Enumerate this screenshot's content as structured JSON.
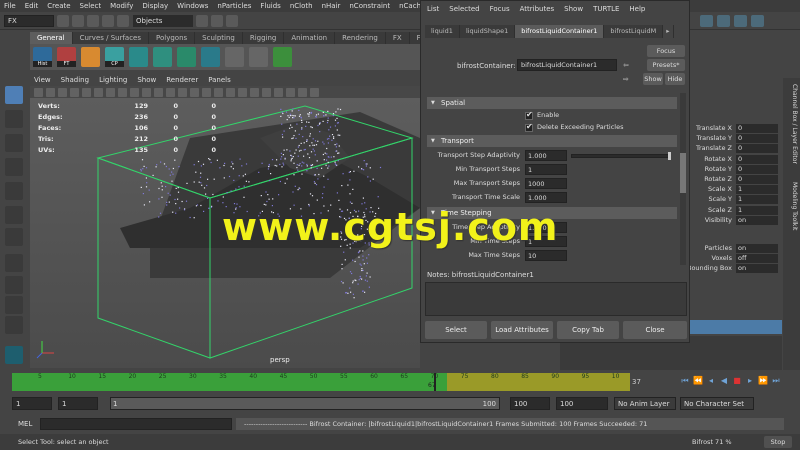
{
  "menu": [
    "File",
    "Edit",
    "Create",
    "Select",
    "Modify",
    "Display",
    "Windows",
    "nParticles",
    "Fluids",
    "nCloth",
    "nHair",
    "nConstraint",
    "nCache"
  ],
  "status": {
    "mode": "FX",
    "object_selector": "Objects"
  },
  "shelf": {
    "tabs": [
      "General",
      "Curves / Surfaces",
      "Polygons",
      "Sculpting",
      "Rigging",
      "Animation",
      "Rendering",
      "FX",
      "FX Cach"
    ],
    "active_tab": "General",
    "buttons": [
      {
        "label": "Hist",
        "color": "#2e6a9a"
      },
      {
        "label": "FT",
        "color": "#b04040"
      },
      {
        "label": "CP",
        "color": "#3aa0a0"
      }
    ]
  },
  "viewport": {
    "menu": [
      "View",
      "Shading",
      "Lighting",
      "Show",
      "Renderer",
      "Panels"
    ],
    "hud": [
      {
        "label": "Verts:",
        "v1": "129",
        "v2": "0",
        "v3": "0"
      },
      {
        "label": "Edges:",
        "v1": "236",
        "v2": "0",
        "v3": "0"
      },
      {
        "label": "Faces:",
        "v1": "106",
        "v2": "0",
        "v3": "0"
      },
      {
        "label": "Tris:",
        "v1": "212",
        "v2": "0",
        "v3": "0"
      },
      {
        "label": "UVs:",
        "v1": "135",
        "v2": "0",
        "v3": "0"
      }
    ],
    "camera": "persp"
  },
  "attribute_editor": {
    "menu": [
      "List",
      "Selected",
      "Focus",
      "Attributes",
      "Show",
      "TURTLE",
      "Help"
    ],
    "tabs": [
      "liquid1",
      "liquidShape1",
      "bifrostLiquidContainer1",
      "bifrostLiquidM"
    ],
    "active_tab": "bifrostLiquidContainer1",
    "node_label": "bifrostContainer:",
    "node_value": "bifrostLiquidContainer1",
    "side_buttons": {
      "focus": "Focus",
      "presets": "Presets*",
      "show": "Show",
      "hide": "Hide"
    },
    "sections": {
      "spatial": "Spatial",
      "transport": "Transport",
      "time_stepping": "Time Stepping"
    },
    "checkboxes": [
      "Enable",
      "Delete Exceeding Particles"
    ],
    "transport_attrs": [
      {
        "label": "Transport Step Adaptivity",
        "value": "1.000",
        "slider": true,
        "fraction": 1.0
      },
      {
        "label": "Min Transport Steps",
        "value": "1",
        "slider": false
      },
      {
        "label": "Max Transport Steps",
        "value": "1000",
        "slider": false
      },
      {
        "label": "Transport Time Scale",
        "value": "1.000",
        "slider": false
      }
    ],
    "time_attrs": [
      {
        "label": "Time Step Adaptivity",
        "value": "1.000"
      },
      {
        "label": "Min Time Steps",
        "value": "1"
      },
      {
        "label": "Max Time Steps",
        "value": "10"
      }
    ],
    "notes_label": "Notes:  bifrostLiquidContainer1",
    "bottom_buttons": [
      "Select",
      "Load Attributes",
      "Copy Tab",
      "Close"
    ]
  },
  "channel_box": {
    "attrs": [
      {
        "label": "Translate X",
        "value": "0"
      },
      {
        "label": "Translate Y",
        "value": "0"
      },
      {
        "label": "Translate Z",
        "value": "0"
      },
      {
        "label": "Rotate X",
        "value": "0"
      },
      {
        "label": "Rotate Y",
        "value": "0"
      },
      {
        "label": "Rotate Z",
        "value": "0"
      },
      {
        "label": "Scale X",
        "value": "1"
      },
      {
        "label": "Scale Y",
        "value": "1"
      },
      {
        "label": "Scale Z",
        "value": "1"
      },
      {
        "label": "Visibility",
        "value": "on"
      }
    ],
    "shape_attrs": [
      {
        "label": "Particles",
        "value": "on"
      },
      {
        "label": "Voxels",
        "value": "off"
      },
      {
        "label": "Bounding Box",
        "value": "on"
      }
    ],
    "side_tabs": [
      "Channel Box / Layer Editor",
      "Modeling Toolkit"
    ]
  },
  "timeline": {
    "ticks": [
      "5",
      "10",
      "15",
      "20",
      "25",
      "30",
      "35",
      "40",
      "45",
      "50",
      "55",
      "60",
      "65",
      "70",
      "75",
      "80",
      "85",
      "90",
      "95",
      "10"
    ],
    "current_frame": "37",
    "playhead_label": "67"
  },
  "range": {
    "start": "1",
    "start_inner": "1",
    "range_start": "1",
    "range_end": "100",
    "end": "100",
    "end_outer": "100",
    "anim_layer": "No Anim Layer",
    "character_set": "No Character Set"
  },
  "command": {
    "label": "MEL",
    "result": "--------------------------- Bifrost Container: |bifrostLiquid1|bifrostLiquidContainer1 Frames Submitted: 100 Frames Succeeded: 71"
  },
  "help": {
    "text": "Select Tool: select an object",
    "progress": "Bifrost 71 %",
    "stop": "Stop"
  },
  "watermark": "www.cgtsj.com"
}
